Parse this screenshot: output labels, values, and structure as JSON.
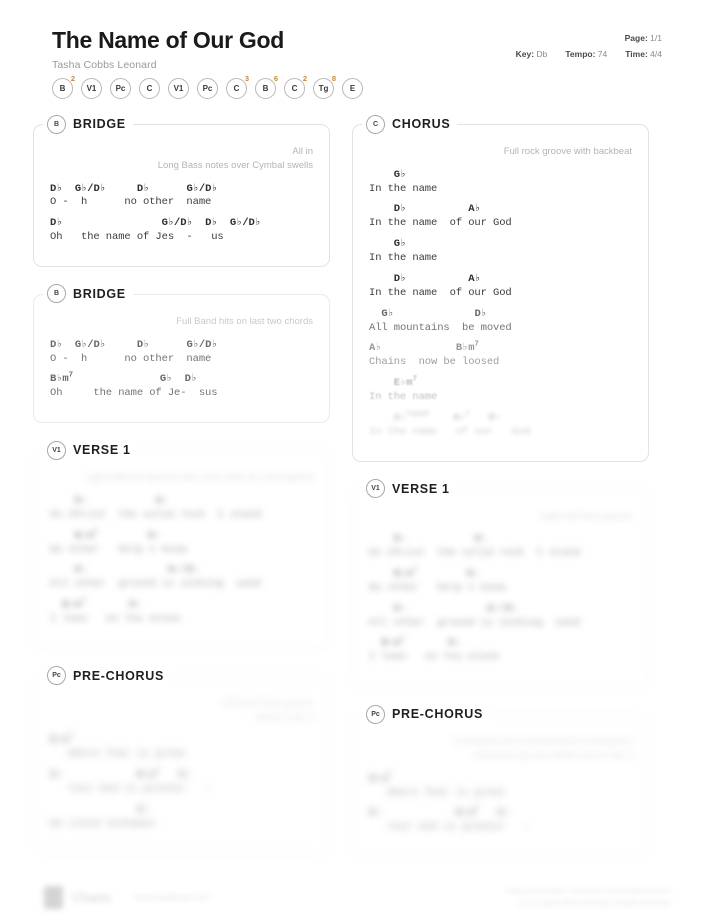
{
  "header": {
    "title": "The Name of Our God",
    "artist": "Tasha Cobbs Leonard",
    "page_label": "Page:",
    "page_value": "1/1",
    "key_label": "Key:",
    "key_value": "Db",
    "tempo_label": "Tempo:",
    "tempo_value": "74",
    "time_label": "Time:",
    "time_value": "4/4"
  },
  "arrangement": [
    {
      "label": "B",
      "sup": "2"
    },
    {
      "label": "V1",
      "sup": ""
    },
    {
      "label": "Pc",
      "sup": ""
    },
    {
      "label": "C",
      "sup": ""
    },
    {
      "label": "V1",
      "sup": ""
    },
    {
      "label": "Pc",
      "sup": ""
    },
    {
      "label": "C",
      "sup": "3"
    },
    {
      "label": "B",
      "sup": "6"
    },
    {
      "label": "C",
      "sup": "2"
    },
    {
      "label": "Tg",
      "sup": "8"
    },
    {
      "label": "E",
      "sup": ""
    }
  ],
  "left_column": [
    {
      "badge": "B",
      "title": "BRIDGE",
      "notes": [
        "All in",
        "Long Bass notes over Cymbal swells"
      ],
      "fade": "f0",
      "lines": [
        {
          "chords": "D♭  G♭/D♭     D♭      G♭/D♭",
          "lyric": "O -  h      no other  name"
        },
        {
          "chords": "D♭                G♭/D♭  D♭  G♭/D♭",
          "lyric": "Oh   the name of Jes  -   us"
        }
      ]
    },
    {
      "badge": "B",
      "title": "BRIDGE",
      "notes": [
        "Full Band hits on last two chords"
      ],
      "fade": "f1",
      "lines": [
        {
          "chords": "D♭  G♭/D♭     D♭      G♭/D♭",
          "lyric": "O -  h      no other  name"
        },
        {
          "chords": "B♭m7              G♭  D♭",
          "lyric": "Oh     the name of Je-  sus"
        }
      ]
    },
    {
      "badge": "V1",
      "title": "VERSE 1",
      "notes": [
        "Light half-time groove with cross stick on 4 throughout"
      ],
      "fade": "b-mid",
      "lines": [
        {
          "chords": "    D♭           G♭",
          "lyric": "On Christ  the solid rock  I stand"
        },
        {
          "chords": "    B♭m7        G♭",
          "lyric": "No other   help I know"
        },
        {
          "chords": "    D♭             G♭/D♭",
          "lyric": "All other  ground is sinking  sand"
        },
        {
          "chords": "  B♭m7       G♭",
          "lyric": "I lean   on You alone"
        }
      ]
    },
    {
      "badge": "Pc",
      "title": "PRE-CHORUS",
      "notes": [
        "Off beat Toms groove",
        "Build to bar 4"
      ],
      "fade": "b-hi",
      "lines": [
        {
          "chords": "B♭m7",
          "lyric": "   Where fear is great"
        },
        {
          "chords": "D♭            B♭m7   G♭",
          "lyric": "   Your God is greater   -"
        },
        {
          "chords": "              G♭",
          "lyric": "We stand unshaken"
        }
      ]
    }
  ],
  "right_column": [
    {
      "badge": "C",
      "title": "CHORUS",
      "notes": [
        "Full rock groove with backbeat"
      ],
      "fade": "f0",
      "lines": [
        {
          "chords": "    G♭",
          "lyric": "In the name",
          "fade": "f0"
        },
        {
          "chords": "    D♭          A♭",
          "lyric": "In the name  of our God",
          "fade": "f0"
        },
        {
          "chords": "    G♭",
          "lyric": "In the name",
          "fade": "f0"
        },
        {
          "chords": "    D♭          A♭",
          "lyric": "In the name  of our God",
          "fade": "f0"
        },
        {
          "chords": "  G♭             D♭",
          "lyric": "All mountains  be moved",
          "fade": "f1"
        },
        {
          "chords": "A♭            B♭m7",
          "lyric": "Chains  now be loosed",
          "fade": "f2"
        },
        {
          "chords": "    E♭m7",
          "lyric": "In the name",
          "fade": "f3"
        },
        {
          "chords": "    A♭7sus4    A♭7   D♭",
          "lyric": "In the name   of our   God",
          "fade": "f4"
        }
      ]
    },
    {
      "badge": "V1",
      "title": "VERSE 1",
      "notes": [
        "Light half-time groove"
      ],
      "fade": "b-mid",
      "lines": [
        {
          "chords": "    D♭           G♭",
          "lyric": "On Christ  the solid rock  I stand"
        },
        {
          "chords": "    B♭m7        G♭",
          "lyric": "No other   help I know"
        },
        {
          "chords": "    D♭             G♭/D♭",
          "lyric": "All other  ground is sinking  sand"
        },
        {
          "chords": "  B♭m7       G♭",
          "lyric": "I lean   on You alone"
        }
      ]
    },
    {
      "badge": "Pc",
      "title": "PRE-CHORUS",
      "notes": [
        "Crescendo and build dynamics throughout",
        "Musicians go one whole step to bar 4"
      ],
      "fade": "b-hi",
      "lines": [
        {
          "chords": "B♭m7",
          "lyric": "   Where fear is great"
        },
        {
          "chords": "D♭            B♭m7   G♭",
          "lyric": "   Your God is greater   -"
        }
      ]
    }
  ],
  "footer": {
    "brand": "Charts",
    "url": "www.multitracks.com",
    "copyright_line1": "Song License Admin. | Neil Harris, Tasha Cobbs Leonard",
    "copyright_line2": "CCLI | Capitol CMG Publishing | All Rights Reserved"
  }
}
